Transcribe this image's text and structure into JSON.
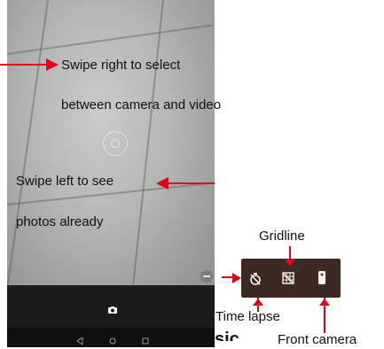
{
  "annotations": {
    "swipe_right_line1": "Swipe right to select",
    "swipe_right_line2": "between camera and video",
    "swipe_left_line1": "Swipe left to see",
    "swipe_left_line2": "photos already"
  },
  "options": {
    "gridline_label": "Gridline",
    "time_lapse_label": "Time lapse",
    "front_camera_label": "Front camera"
  },
  "cropped_text": "sic",
  "colors": {
    "arrow": "#e3001b",
    "panel": "#3b2a20",
    "bottom_bar": "#1b1b1b"
  },
  "icons": {
    "shutter": "camera-icon",
    "time_lapse": "timer-icon",
    "gridline": "grid-icon",
    "front_camera": "front-camera-icon"
  }
}
